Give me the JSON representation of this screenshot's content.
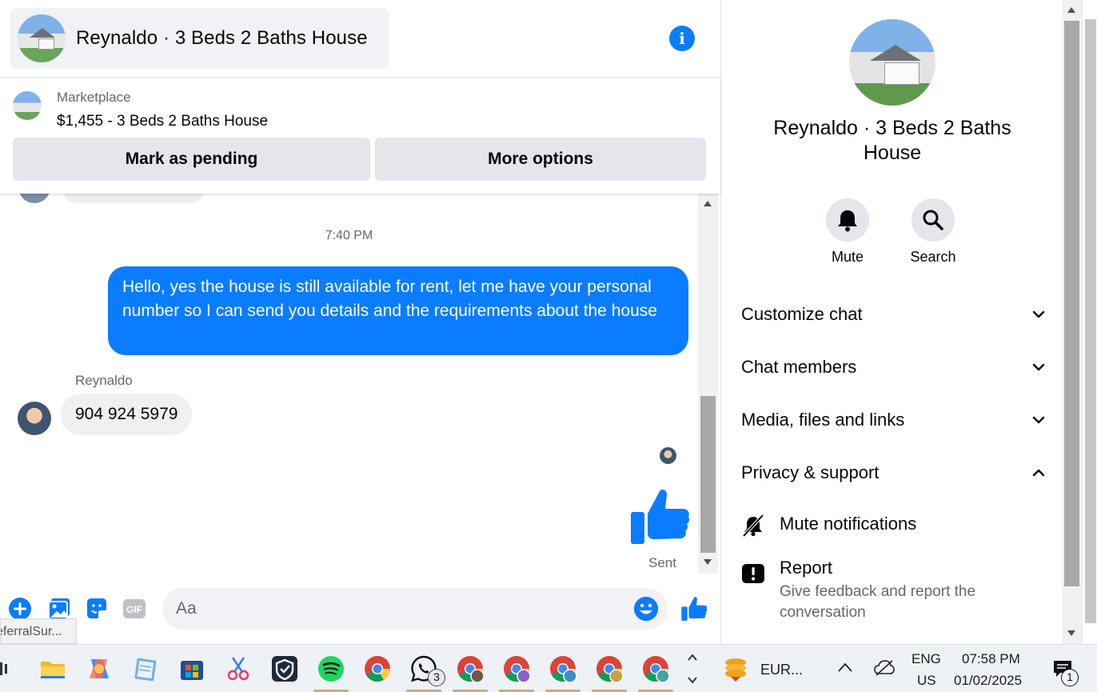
{
  "header": {
    "title": "Reynaldo · 3 Beds 2 Baths House",
    "avatar_icon": "house-photo-avatar",
    "info_icon": "info-icon"
  },
  "marketplace": {
    "label": "Marketplace",
    "listing": "$1,455 - 3 Beds 2 Baths House",
    "mark_pending_label": "Mark as pending",
    "more_options_label": "More options"
  },
  "messages": {
    "timestamp": "7:40 PM",
    "outgoing_text": "Hello, yes the house is still available for rent, let me have your personal number so I can send you details and the requirements about the house",
    "sender_name": "Reynaldo",
    "incoming_text": "904 924 5979",
    "status": "Sent"
  },
  "composer": {
    "placeholder": "Aa",
    "icons": [
      "plus-icon",
      "photo-icon",
      "sticker-icon",
      "gif-icon",
      "emoji-icon",
      "thumbs-up-icon"
    ],
    "gif_label": "GIF",
    "tooltip_fragment": "eferralSur..."
  },
  "details": {
    "title": "Reynaldo · 3 Beds 2 Baths House",
    "mute_label": "Mute",
    "search_label": "Search",
    "sections": {
      "customize": "Customize chat",
      "members": "Chat members",
      "media": "Media, files and links",
      "privacy": "Privacy & support"
    },
    "mute_notifications": "Mute notifications",
    "report_title": "Report",
    "report_desc": "Give feedback and report the conversation"
  },
  "taskbar": {
    "whatsapp_badge": "3",
    "weather_text": "EUR...",
    "lang_top": "ENG",
    "lang_bottom": "US",
    "time": "07:58 PM",
    "date": "01/02/2025",
    "notification_count": "1"
  },
  "colors": {
    "accent": "#0a7cff",
    "bubble_in": "#f0f0f0",
    "button_gray": "#e4e6eb"
  }
}
